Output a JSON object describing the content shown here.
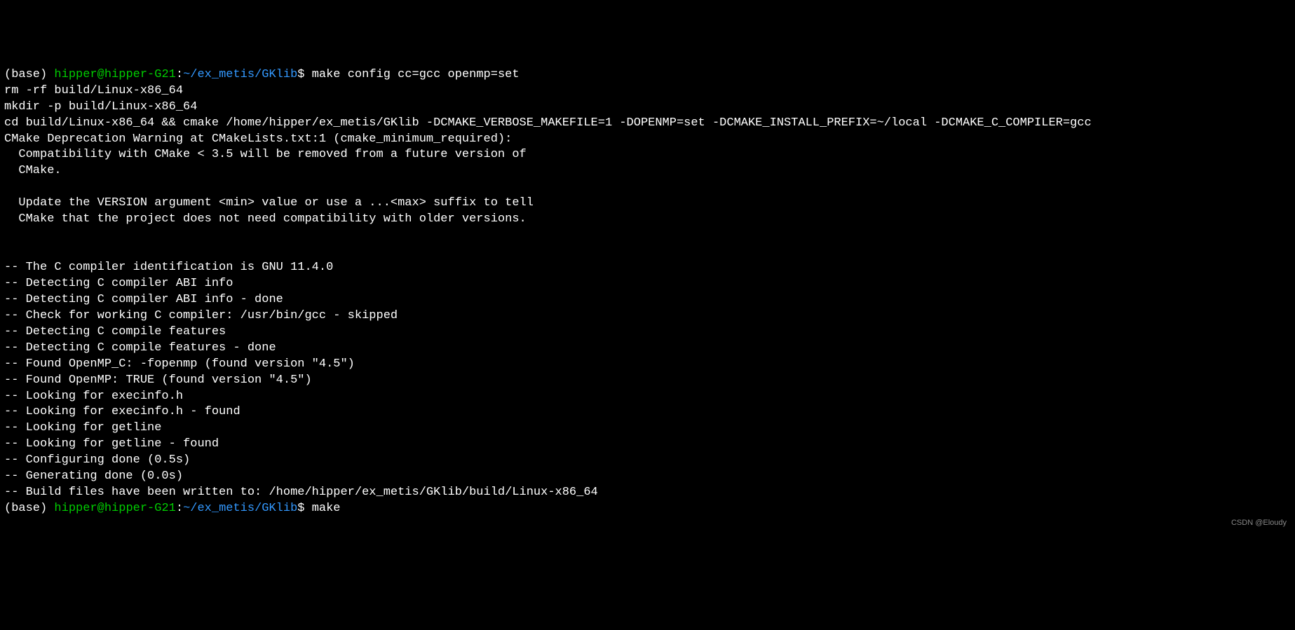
{
  "prompt1": {
    "env": "(base) ",
    "user": "hipper@hipper-G21",
    "colon": ":",
    "path": "~/ex_metis/GKlib",
    "dollar": "$ ",
    "command": "make config cc=gcc openmp=set"
  },
  "output_lines": [
    "rm -rf build/Linux-x86_64",
    "mkdir -p build/Linux-x86_64",
    "cd build/Linux-x86_64 && cmake /home/hipper/ex_metis/GKlib -DCMAKE_VERBOSE_MAKEFILE=1 -DOPENMP=set -DCMAKE_INSTALL_PREFIX=~/local -DCMAKE_C_COMPILER=gcc",
    "CMake Deprecation Warning at CMakeLists.txt:1 (cmake_minimum_required):",
    "  Compatibility with CMake < 3.5 will be removed from a future version of",
    "  CMake.",
    "",
    "  Update the VERSION argument <min> value or use a ...<max> suffix to tell",
    "  CMake that the project does not need compatibility with older versions.",
    "",
    "",
    "-- The C compiler identification is GNU 11.4.0",
    "-- Detecting C compiler ABI info",
    "-- Detecting C compiler ABI info - done",
    "-- Check for working C compiler: /usr/bin/gcc - skipped",
    "-- Detecting C compile features",
    "-- Detecting C compile features - done",
    "-- Found OpenMP_C: -fopenmp (found version \"4.5\")",
    "-- Found OpenMP: TRUE (found version \"4.5\")",
    "-- Looking for execinfo.h",
    "-- Looking for execinfo.h - found",
    "-- Looking for getline",
    "-- Looking for getline - found",
    "-- Configuring done (0.5s)",
    "-- Generating done (0.0s)",
    "-- Build files have been written to: /home/hipper/ex_metis/GKlib/build/Linux-x86_64"
  ],
  "prompt2": {
    "env": "(base) ",
    "user": "hipper@hipper-G21",
    "colon": ":",
    "path": "~/ex_metis/GKlib",
    "dollar": "$ ",
    "command": "make"
  },
  "watermark": "CSDN @Eloudy"
}
